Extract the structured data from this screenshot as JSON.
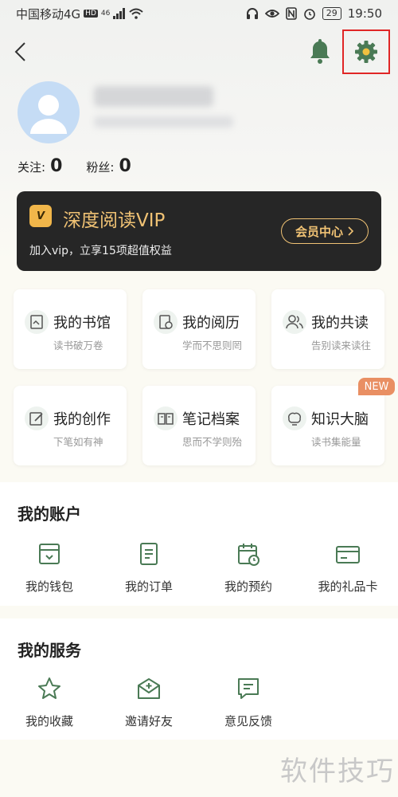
{
  "status_bar": {
    "carrier": "中国移动4G",
    "hd": "HD",
    "net": "46",
    "battery": "29",
    "time": "19:50"
  },
  "profile": {
    "follow_label": "关注:",
    "follow_count": "0",
    "fans_label": "粉丝:",
    "fans_count": "0"
  },
  "vip": {
    "badge": "V",
    "title": "深度阅读VIP",
    "desc": "加入vip，立享15项超值权益",
    "button": "会员中心"
  },
  "cards": [
    {
      "title": "我的书馆",
      "subtitle": "读书破万卷",
      "icon": "library-icon"
    },
    {
      "title": "我的阅历",
      "subtitle": "学而不思则罔",
      "icon": "history-icon"
    },
    {
      "title": "我的共读",
      "subtitle": "告别读来读往",
      "icon": "group-read-icon"
    },
    {
      "title": "我的创作",
      "subtitle": "下笔如有神",
      "icon": "edit-icon"
    },
    {
      "title": "笔记档案",
      "subtitle": "思而不学则殆",
      "icon": "notes-icon"
    },
    {
      "title": "知识大脑",
      "subtitle": "读书集能量",
      "icon": "brain-icon"
    }
  ],
  "new_badge": "NEW",
  "account": {
    "title": "我的账户",
    "items": [
      {
        "label": "我的钱包",
        "icon": "wallet-icon"
      },
      {
        "label": "我的订单",
        "icon": "order-icon"
      },
      {
        "label": "我的预约",
        "icon": "calendar-icon"
      },
      {
        "label": "我的礼品卡",
        "icon": "gift-card-icon"
      }
    ]
  },
  "service": {
    "title": "我的服务",
    "items": [
      {
        "label": "我的收藏",
        "icon": "star-icon"
      },
      {
        "label": "邀请好友",
        "icon": "invite-icon"
      },
      {
        "label": "意见反馈",
        "icon": "feedback-icon"
      }
    ]
  },
  "watermark": "软件技巧",
  "colors": {
    "accent_green": "#4a7a55",
    "gold": "#f0c274",
    "highlight_red": "#e02626"
  }
}
